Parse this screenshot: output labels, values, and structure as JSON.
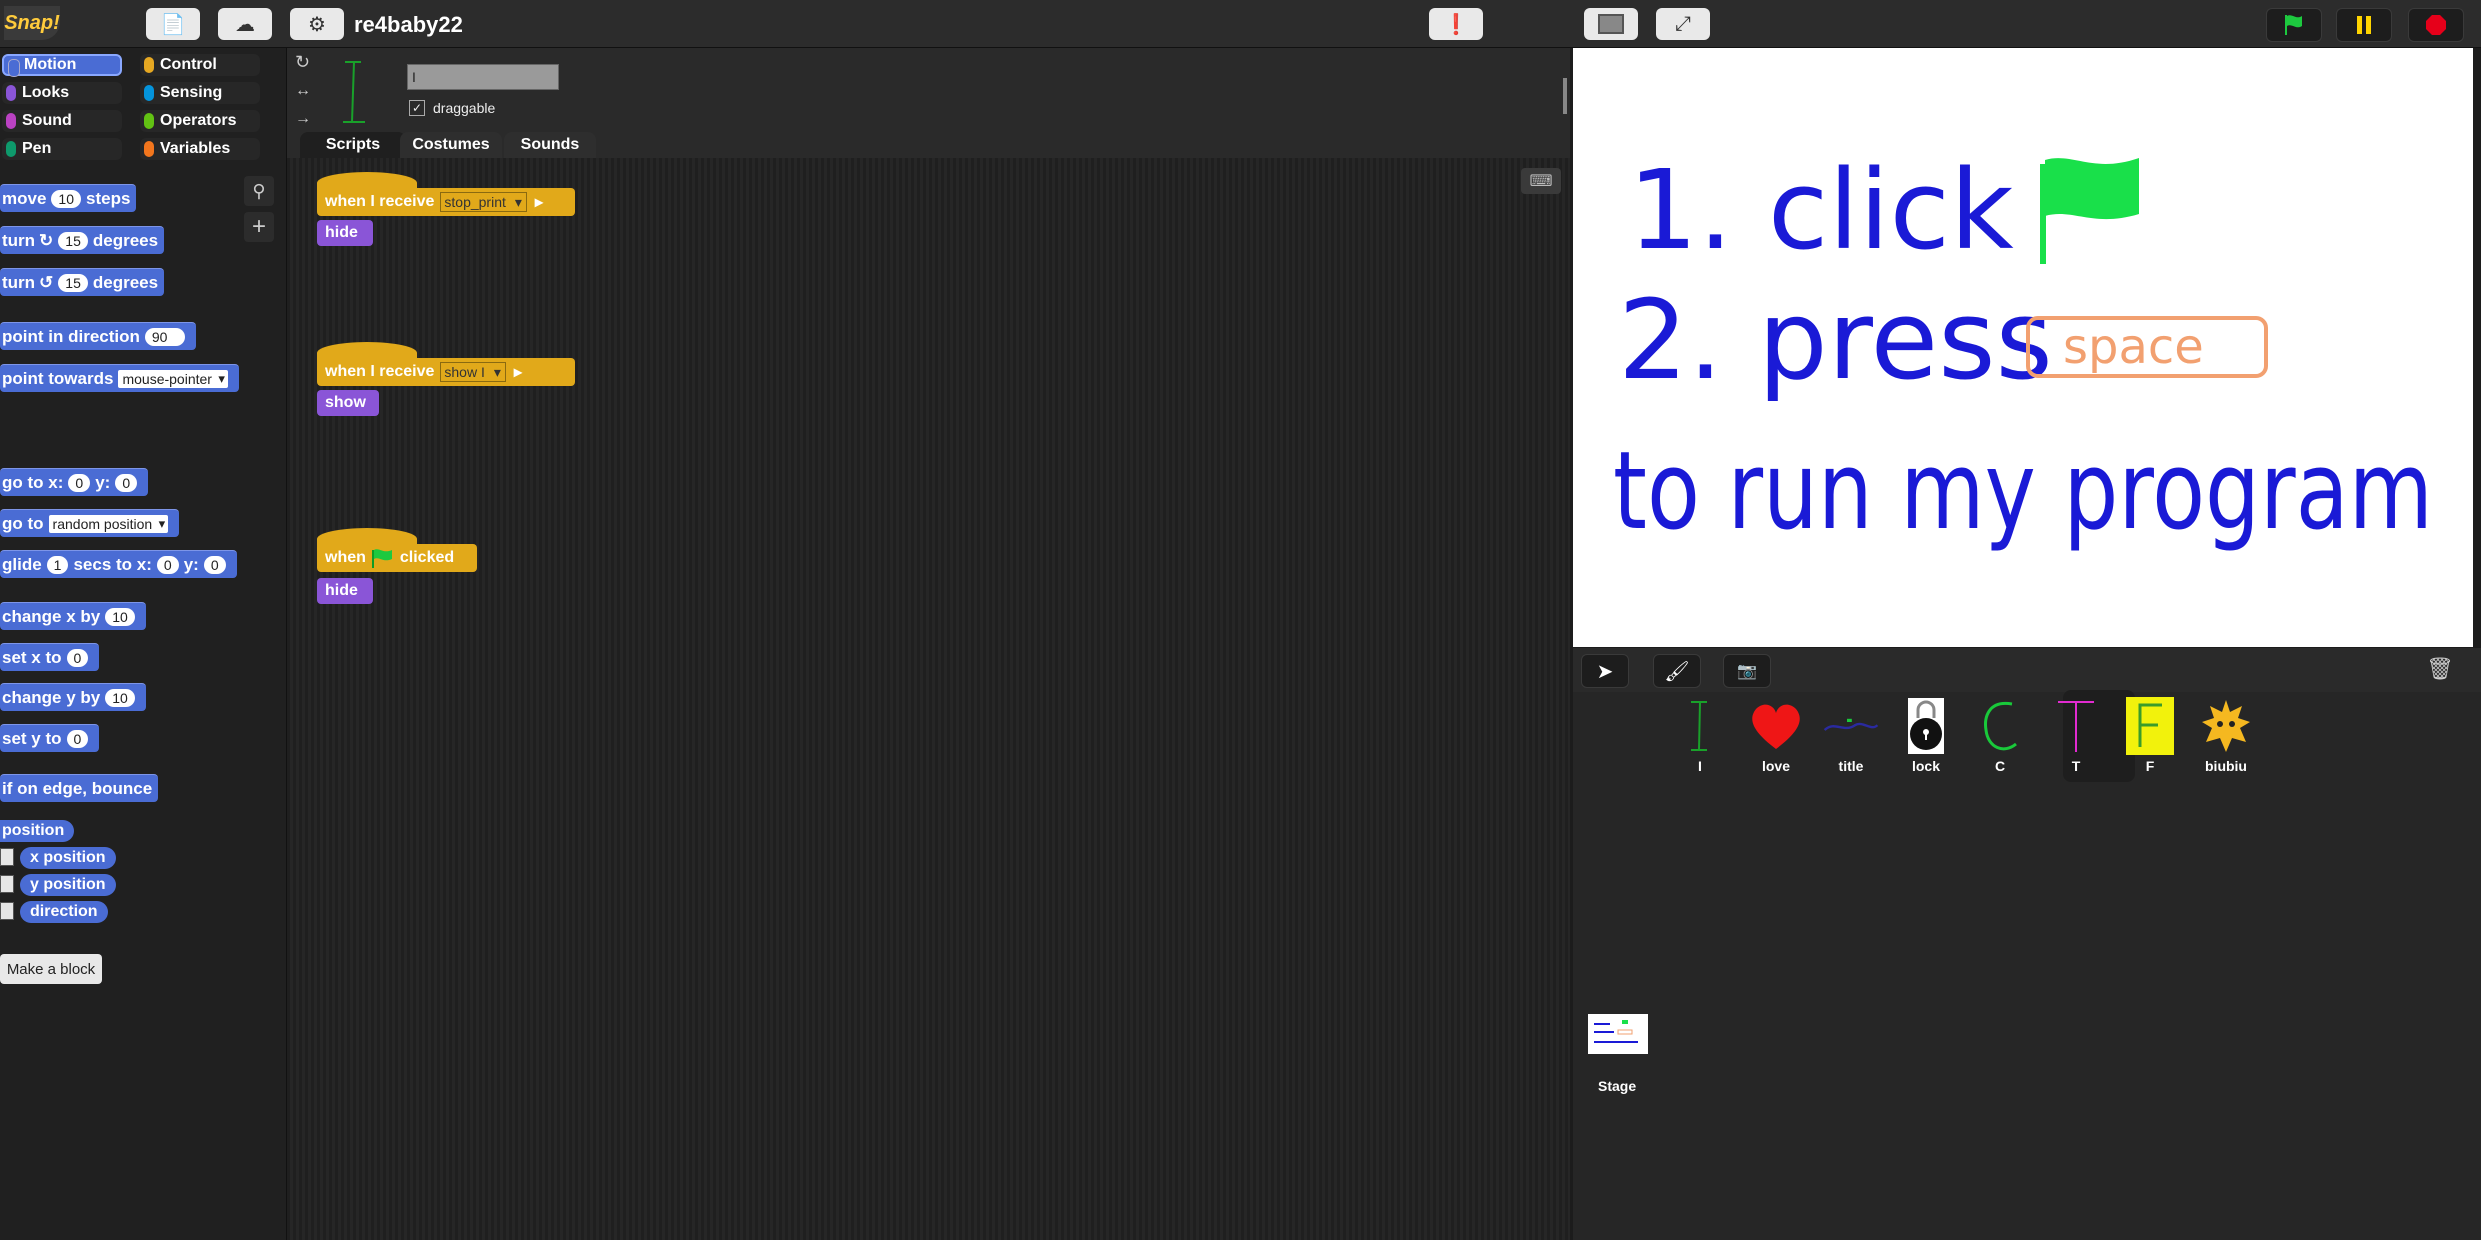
{
  "app": {
    "logo_text": "Snap!",
    "project_name": "re4baby22"
  },
  "categories": [
    {
      "label": "Motion",
      "color": "#4a6cd4",
      "selected": true
    },
    {
      "label": "Looks",
      "color": "#8a55d7"
    },
    {
      "label": "Sound",
      "color": "#bb42c3"
    },
    {
      "label": "Pen",
      "color": "#0e9a6c"
    },
    {
      "label": "Control",
      "color": "#e6a822"
    },
    {
      "label": "Sensing",
      "color": "#0494dc"
    },
    {
      "label": "Operators",
      "color": "#62c213"
    },
    {
      "label": "Variables",
      "color": "#f3761d"
    }
  ],
  "sprite": {
    "name": "I",
    "draggable_label": "draggable"
  },
  "tabs": [
    "Scripts",
    "Costumes",
    "Sounds"
  ],
  "palette": {
    "move": {
      "a": "move",
      "v": "10",
      "b": "steps"
    },
    "turn_cw": {
      "a": "turn",
      "v": "15",
      "b": "degrees"
    },
    "turn_ccw": {
      "a": "turn",
      "v": "15",
      "b": "degrees"
    },
    "point_dir": {
      "a": "point in direction",
      "v": "90"
    },
    "point_towards": {
      "a": "point towards",
      "v": "mouse-pointer"
    },
    "goto_xy": {
      "a": "go to x:",
      "x": "0",
      "b": "y:",
      "y": "0"
    },
    "goto": {
      "a": "go to",
      "v": "random position"
    },
    "glide": {
      "a": "glide",
      "s": "1",
      "b": "secs to x:",
      "x": "0",
      "c": "y:",
      "y": "0"
    },
    "change_x": {
      "a": "change x by",
      "v": "10"
    },
    "set_x": {
      "a": "set x to",
      "v": "0"
    },
    "change_y": {
      "a": "change y by",
      "v": "10"
    },
    "set_y": {
      "a": "set y to",
      "v": "0"
    },
    "bounce": "if on edge, bounce",
    "position": "position",
    "x_position": "x position",
    "y_position": "y position",
    "direction": "direction",
    "make_block": "Make a block"
  },
  "scripts": [
    {
      "hat": "when I receive",
      "msg": "stop_print",
      "cmd": "hide"
    },
    {
      "hat": "when I receive",
      "msg": "show I",
      "cmd": "show"
    },
    {
      "hat_a": "when",
      "hat_b": "clicked",
      "cmd": "hide"
    }
  ],
  "stage_text": {
    "line1": "1. click",
    "line2": "2. press",
    "key": "space",
    "line3": "to run my program"
  },
  "corral": {
    "sprites": [
      "I",
      "love",
      "title",
      "lock",
      "C",
      "T",
      "F",
      "biubiu"
    ],
    "stage_label": "Stage"
  }
}
